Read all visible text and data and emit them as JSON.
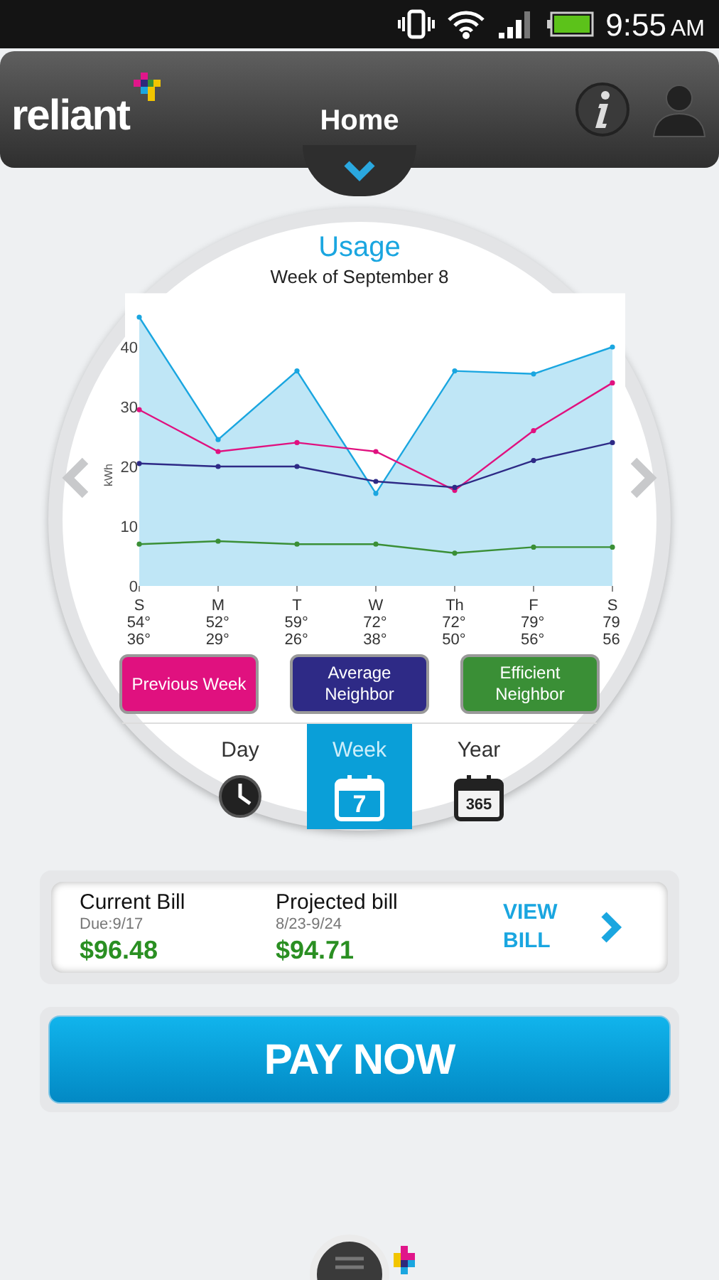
{
  "status_bar": {
    "time": "9:55",
    "meridiem": "AM"
  },
  "header": {
    "logo": "reliant",
    "title": "Home"
  },
  "usage": {
    "title": "Usage",
    "subtitle": "Week of September 8",
    "chart_data": {
      "type": "line",
      "ylabel": "kWh",
      "categories": [
        "S",
        "M",
        "T",
        "W",
        "Th",
        "F",
        "S"
      ],
      "ylim": [
        0,
        49
      ],
      "yticks": [
        0,
        10,
        20,
        30,
        40
      ],
      "series": [
        {
          "type": "area",
          "marker": "o",
          "color": "#1aa6e0",
          "values": [
            45,
            24.5,
            36,
            15.5,
            36,
            35.5,
            40
          ]
        },
        {
          "name": "Previous Week",
          "type": "line",
          "marker": "o",
          "color": "#e0117f",
          "values": [
            29.5,
            22.5,
            24,
            22.5,
            16,
            26,
            34
          ]
        },
        {
          "name": "Average Neighbor",
          "type": "line",
          "marker": "o",
          "color": "#2e2a86",
          "values": [
            20.5,
            20,
            20,
            17.5,
            16.5,
            21,
            24
          ]
        },
        {
          "name": "Efficient Neighbor",
          "type": "line",
          "marker": "o",
          "color": "#3a8f36",
          "values": [
            7,
            7.5,
            7,
            7,
            5.5,
            6.5,
            6.5
          ]
        }
      ]
    },
    "temperatures": [
      {
        "high": "54°",
        "low": "36°"
      },
      {
        "high": "52°",
        "low": "29°"
      },
      {
        "high": "59°",
        "low": "26°"
      },
      {
        "high": "72°",
        "low": "38°"
      },
      {
        "high": "72°",
        "low": "50°"
      },
      {
        "high": "79°",
        "low": "56°"
      },
      {
        "high": "79",
        "low": "56"
      }
    ],
    "tabs": [
      {
        "label": "Day",
        "kind": "clock",
        "selected": false
      },
      {
        "label": "Week",
        "kind": "calendar",
        "icon_text": "7",
        "selected": true
      },
      {
        "label": "Year",
        "kind": "calendar",
        "icon_text": "365",
        "selected": false
      }
    ]
  },
  "bill": {
    "current": {
      "label": "Current Bill",
      "note": "Due:9/17",
      "amount": "$96.48"
    },
    "projected": {
      "label": "Projected bill",
      "note": "8/23-9/24",
      "amount": "$94.71"
    },
    "link": "VIEW BILL"
  },
  "pay_button": "PAY NOW"
}
